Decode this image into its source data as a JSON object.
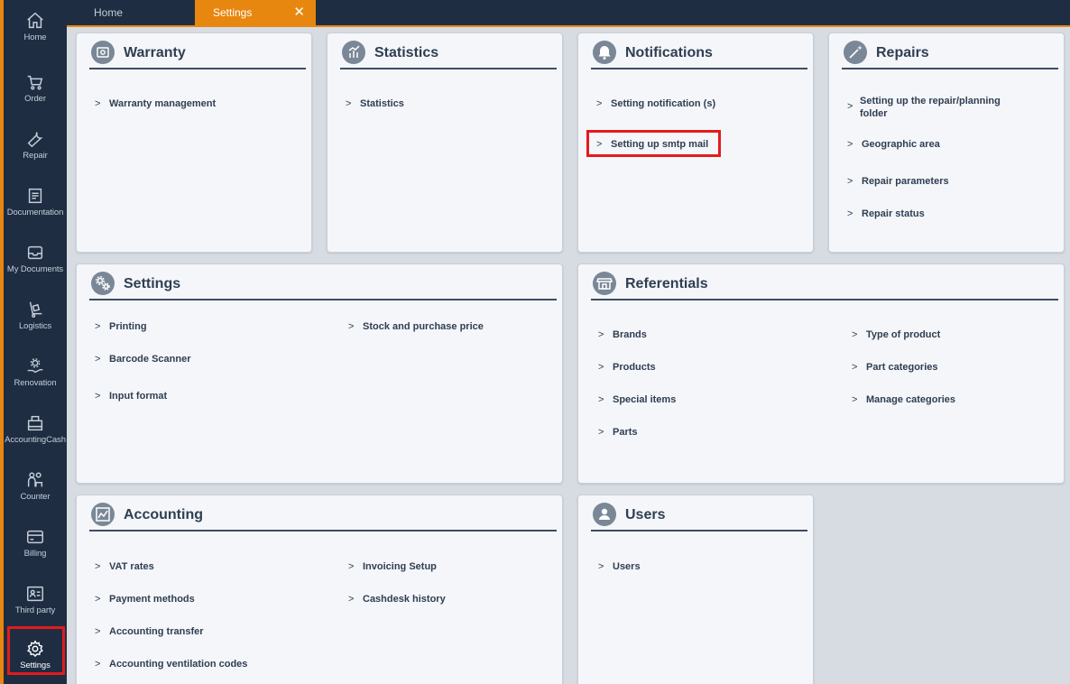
{
  "nav": {
    "home": "Home",
    "order": "Order",
    "repair": "Repair",
    "documentation": "Documentation",
    "my_documents": "My Documents",
    "logistics": "Logistics",
    "renovation": "Renovation",
    "accounting_cash": "AccountingCash",
    "counter": "Counter",
    "billing": "Billing",
    "third_party": "Third party",
    "settings": "Settings"
  },
  "tabs": {
    "home": "Home",
    "settings": "Settings",
    "close": "✕"
  },
  "chevron": ">",
  "colors": {
    "accent": "#e8870f",
    "sidebar": "#1e2d42",
    "highlight": "#e41b1b"
  },
  "cards": {
    "warranty": {
      "title": "Warranty",
      "icon": "safe-icon",
      "links": [
        "Warranty management"
      ]
    },
    "statistics": {
      "title": "Statistics",
      "icon": "statistics-icon",
      "links": [
        "Statistics"
      ]
    },
    "notifications": {
      "title": "Notifications",
      "icon": "bell-icon",
      "links": [
        "Setting notification (s)",
        "Setting up smtp mail"
      ]
    },
    "repairs": {
      "title": "Repairs",
      "icon": "magic-wand-icon",
      "links": [
        "Setting up the repair/planning folder",
        "Geographic area",
        "Repair parameters",
        "Repair status"
      ]
    },
    "settings": {
      "title": "Settings",
      "icon": "gears-icon",
      "links": [
        "Printing",
        "Stock and purchase price",
        "Barcode Scanner",
        "Input format"
      ]
    },
    "referentials": {
      "title": "Referentials",
      "icon": "store-icon",
      "links": [
        "Brands",
        "Type of product",
        "Products",
        "Part categories",
        "Special items",
        "Manage categories",
        "Parts"
      ]
    },
    "accounting": {
      "title": "Accounting",
      "icon": "chart-icon",
      "links": [
        "VAT rates",
        "Invoicing Setup",
        "Payment methods",
        "Cashdesk history",
        "Accounting transfer",
        "Accounting ventilation codes"
      ]
    },
    "users": {
      "title": "Users",
      "icon": "user-icon",
      "links": [
        "Users"
      ]
    }
  }
}
